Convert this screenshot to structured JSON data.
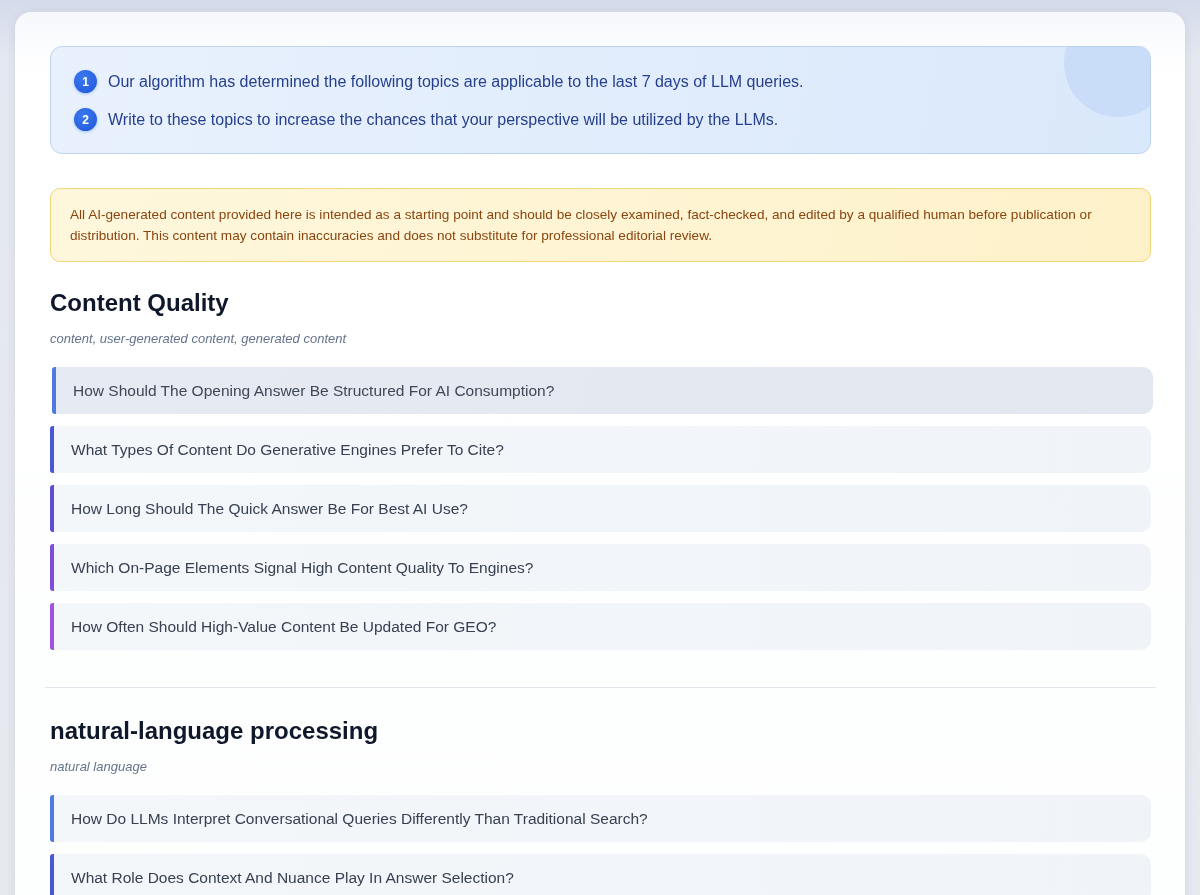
{
  "intro": {
    "steps": [
      {
        "number": "1",
        "text": "Our algorithm has determined the following topics are applicable to the last 7 days of LLM queries."
      },
      {
        "number": "2",
        "text": "Write to these topics to increase the chances that your perspective will be utilized by the LLMs."
      }
    ]
  },
  "disclaimer": "All AI-generated content provided here is intended as a starting point and should be closely examined, fact-checked, and edited by a qualified human before publication or distribution. This content may contain inaccuracies and does not substitute for professional editorial review.",
  "topics": [
    {
      "title": "Content Quality",
      "keywords": "content, user-generated content, generated content",
      "questions": [
        {
          "text": "How Should The Opening Answer Be Structured For AI Consumption?",
          "selected": true,
          "color": "#4f7be0"
        },
        {
          "text": "What Types Of Content Do Generative Engines Prefer To Cite?",
          "selected": false,
          "color": "#4b55d8"
        },
        {
          "text": "How Long Should The Quick Answer Be For Best AI Use?",
          "selected": false,
          "color": "#5e4cd6"
        },
        {
          "text": "Which On-Page Elements Signal High Content Quality To Engines?",
          "selected": false,
          "color": "#7e4ddc"
        },
        {
          "text": "How Often Should High-Value Content Be Updated For GEO?",
          "selected": false,
          "color": "#a34fe0"
        }
      ]
    },
    {
      "title": "natural-language processing",
      "keywords": "natural language",
      "questions": [
        {
          "text": "How Do LLMs Interpret Conversational Queries Differently Than Traditional Search?",
          "selected": false,
          "color": "#4f7be0"
        },
        {
          "text": "What Role Does Context And Nuance Play In Answer Selection?",
          "selected": false,
          "color": "#4b55d8"
        }
      ]
    }
  ]
}
